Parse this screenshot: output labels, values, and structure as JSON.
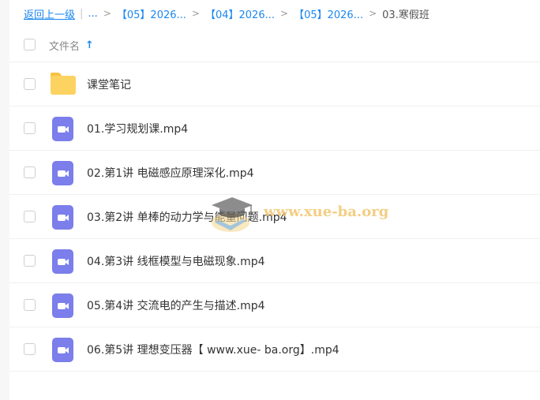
{
  "breadcrumb": {
    "back": "返回上一级",
    "separator": "|",
    "ellipsis": "...",
    "arrow": ">",
    "items": [
      "【05】2026...",
      "【04】2026...",
      "【05】2026..."
    ],
    "current": "03.寒假班"
  },
  "table": {
    "header": {
      "name_label": "文件名",
      "sort_indicator": "↑"
    },
    "rows": [
      {
        "name": "课堂笔记",
        "icon": "folder-icon"
      },
      {
        "name": "01.学习规划课.mp4",
        "icon": "video-icon"
      },
      {
        "name": "02.第1讲 电磁感应原理深化.mp4",
        "icon": "video-icon"
      },
      {
        "name": "03.第2讲 单棒的动力学与能量问题.mp4",
        "icon": "video-icon"
      },
      {
        "name": "04.第3讲 线框模型与电磁现象.mp4",
        "icon": "video-icon"
      },
      {
        "name": "05.第4讲 交流电的产生与描述.mp4",
        "icon": "video-icon"
      },
      {
        "name": "06.第5讲 理想变压器【 www.xue- ba.org】.mp4",
        "icon": "video-icon"
      }
    ]
  },
  "watermark": {
    "text": "www.xue-ba.org"
  },
  "colors": {
    "link": "#1b87f0",
    "folder": "#fcd260",
    "video": "#7b7eeb",
    "watermark": "#f1c66e"
  }
}
